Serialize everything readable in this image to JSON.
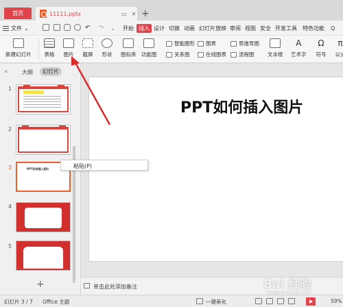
{
  "titlebar": {
    "home_tab": "首页",
    "doc_tab": "11111.pptx",
    "add_tab": "+"
  },
  "menubar": {
    "file_label": "文件",
    "tabs": [
      {
        "label": "开始",
        "active": false
      },
      {
        "label": "插入",
        "active": true
      },
      {
        "label": "设计",
        "active": false
      },
      {
        "label": "切换",
        "active": false
      },
      {
        "label": "动画",
        "active": false
      },
      {
        "label": "幻灯片放映",
        "active": false
      },
      {
        "label": "审阅",
        "active": false
      },
      {
        "label": "视图",
        "active": false
      },
      {
        "label": "安全",
        "active": false
      },
      {
        "label": "开发工具",
        "active": false
      },
      {
        "label": "特色功能",
        "active": false
      }
    ]
  },
  "ribbon": {
    "new_slide": "新建幻灯片",
    "table": "表格",
    "picture": "图片",
    "screenshot": "截屏",
    "shape": "形状",
    "icon_library": "图标库",
    "function_chart": "功能图",
    "smart_graphic": "智能图形",
    "chart": "图表",
    "relation_chart": "关系图",
    "online_flowchart": "在线图表",
    "mind_map": "思维导图",
    "flowchart": "流程图",
    "text_box": "文本框",
    "art_text": "艺术字",
    "symbol": "符号",
    "formula": "公式"
  },
  "left_panel": {
    "outline_tab": "大纲",
    "slides_tab": "幻灯片",
    "thumbs": [
      {
        "num": "1"
      },
      {
        "num": "2"
      },
      {
        "num": "3",
        "title": "PPT如何插入图片"
      },
      {
        "num": "4"
      },
      {
        "num": "5"
      }
    ],
    "add_label": "+"
  },
  "slide": {
    "title": "PPT如何插入图片"
  },
  "context_menu": {
    "paste": "粘贴(P)"
  },
  "notes": {
    "placeholder": "单击此处添加备注"
  },
  "statusbar": {
    "slide_info": "幻灯片 3 / 7",
    "theme": "Office 主题",
    "beautify": "一键美化",
    "zoom": "59%"
  },
  "watermark": {
    "text": "Bai 经验",
    "sub": "jingyan.baidu.com"
  },
  "colors": {
    "accent_red": "#e0454b",
    "highlight_orange": "#e9602b",
    "arrow_red": "#d92b2b"
  }
}
